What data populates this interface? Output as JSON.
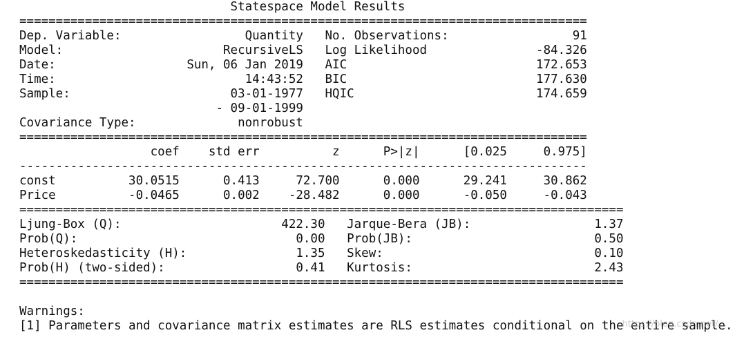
{
  "title": "Statespace Model Results",
  "model_info": {
    "dep_variable_label": "Dep. Variable:",
    "dep_variable": "Quantity",
    "model_label": "Model:",
    "model": "RecursiveLS",
    "date_label": "Date:",
    "date": "Sun, 06 Jan 2019",
    "time_label": "Time:",
    "time": "14:43:52",
    "sample_label": "Sample:",
    "sample_start": "03-01-1977",
    "sample_end": "- 09-01-1999",
    "covariance_label": "Covariance Type:",
    "covariance": "nonrobust",
    "nobs_label": "No. Observations:",
    "nobs": "91",
    "llf_label": "Log Likelihood",
    "llf": "-84.326",
    "aic_label": "AIC",
    "aic": "172.653",
    "bic_label": "BIC",
    "bic": "177.630",
    "hqic_label": "HQIC",
    "hqic": "174.659"
  },
  "coef_table": {
    "headers": [
      "",
      "coef",
      "std err",
      "z",
      "P>|z|",
      "[0.025",
      "0.975]"
    ],
    "rows": [
      [
        "const",
        "30.0515",
        "0.413",
        "72.700",
        "0.000",
        "29.241",
        "30.862"
      ],
      [
        "Price",
        "-0.0465",
        "0.002",
        "-28.482",
        "0.000",
        "-0.050",
        "-0.043"
      ]
    ]
  },
  "diagnostics": {
    "rows": [
      [
        "Ljung-Box (Q):",
        "422.30",
        "Jarque-Bera (JB):",
        "1.37"
      ],
      [
        "Prob(Q):",
        "0.00",
        "Prob(JB):",
        "0.50"
      ],
      [
        "Heteroskedasticity (H):",
        "1.35",
        "Skew:",
        "0.10"
      ],
      [
        "Prob(H) (two-sided):",
        "0.41",
        "Kurtosis:",
        "2.43"
      ]
    ]
  },
  "warnings": {
    "heading": "Warnings:",
    "items": [
      "[1] Parameters and covariance matrix estimates are RLS estimates conditional on the entire sample."
    ]
  },
  "watermark": "https://blog.csdn.net/..."
}
